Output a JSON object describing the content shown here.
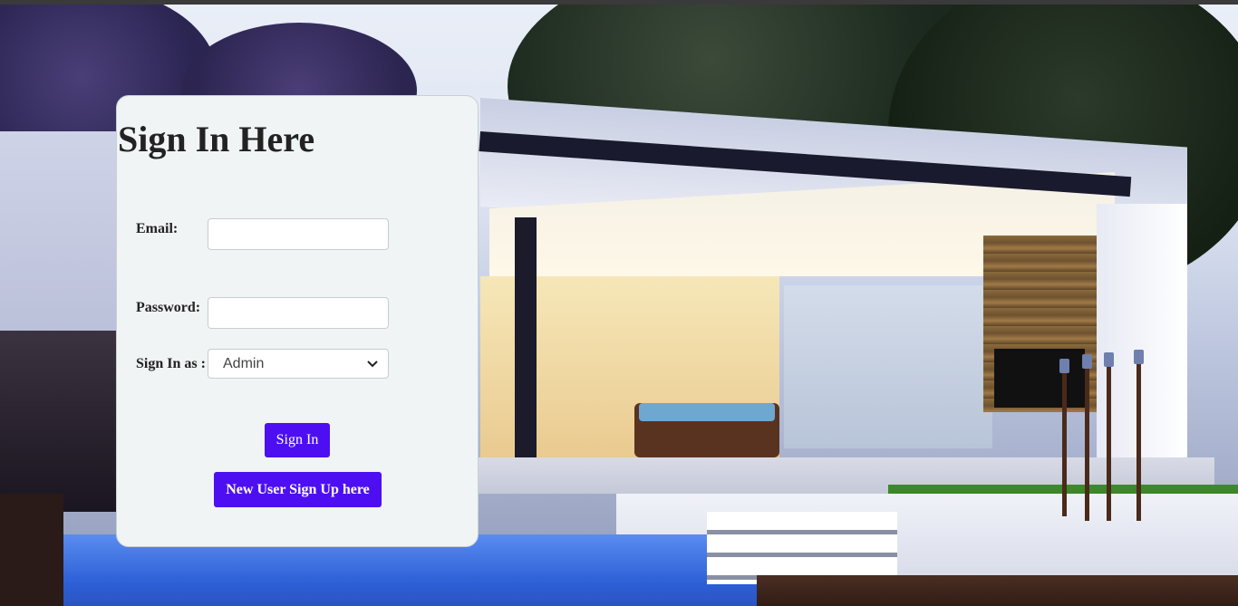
{
  "form": {
    "title": "Sign In Here",
    "email_label": "Email:",
    "email_value": "",
    "password_label": "Password:",
    "password_value": "",
    "role_label": "Sign In as :",
    "role_selected": "Admin",
    "signin_button": "Sign In",
    "signup_button": "New User Sign Up here"
  },
  "colors": {
    "button_bg": "#4d0ff2",
    "card_bg": "#f0f4f4"
  },
  "icons": {
    "select_arrow": "chevron-down-icon"
  }
}
